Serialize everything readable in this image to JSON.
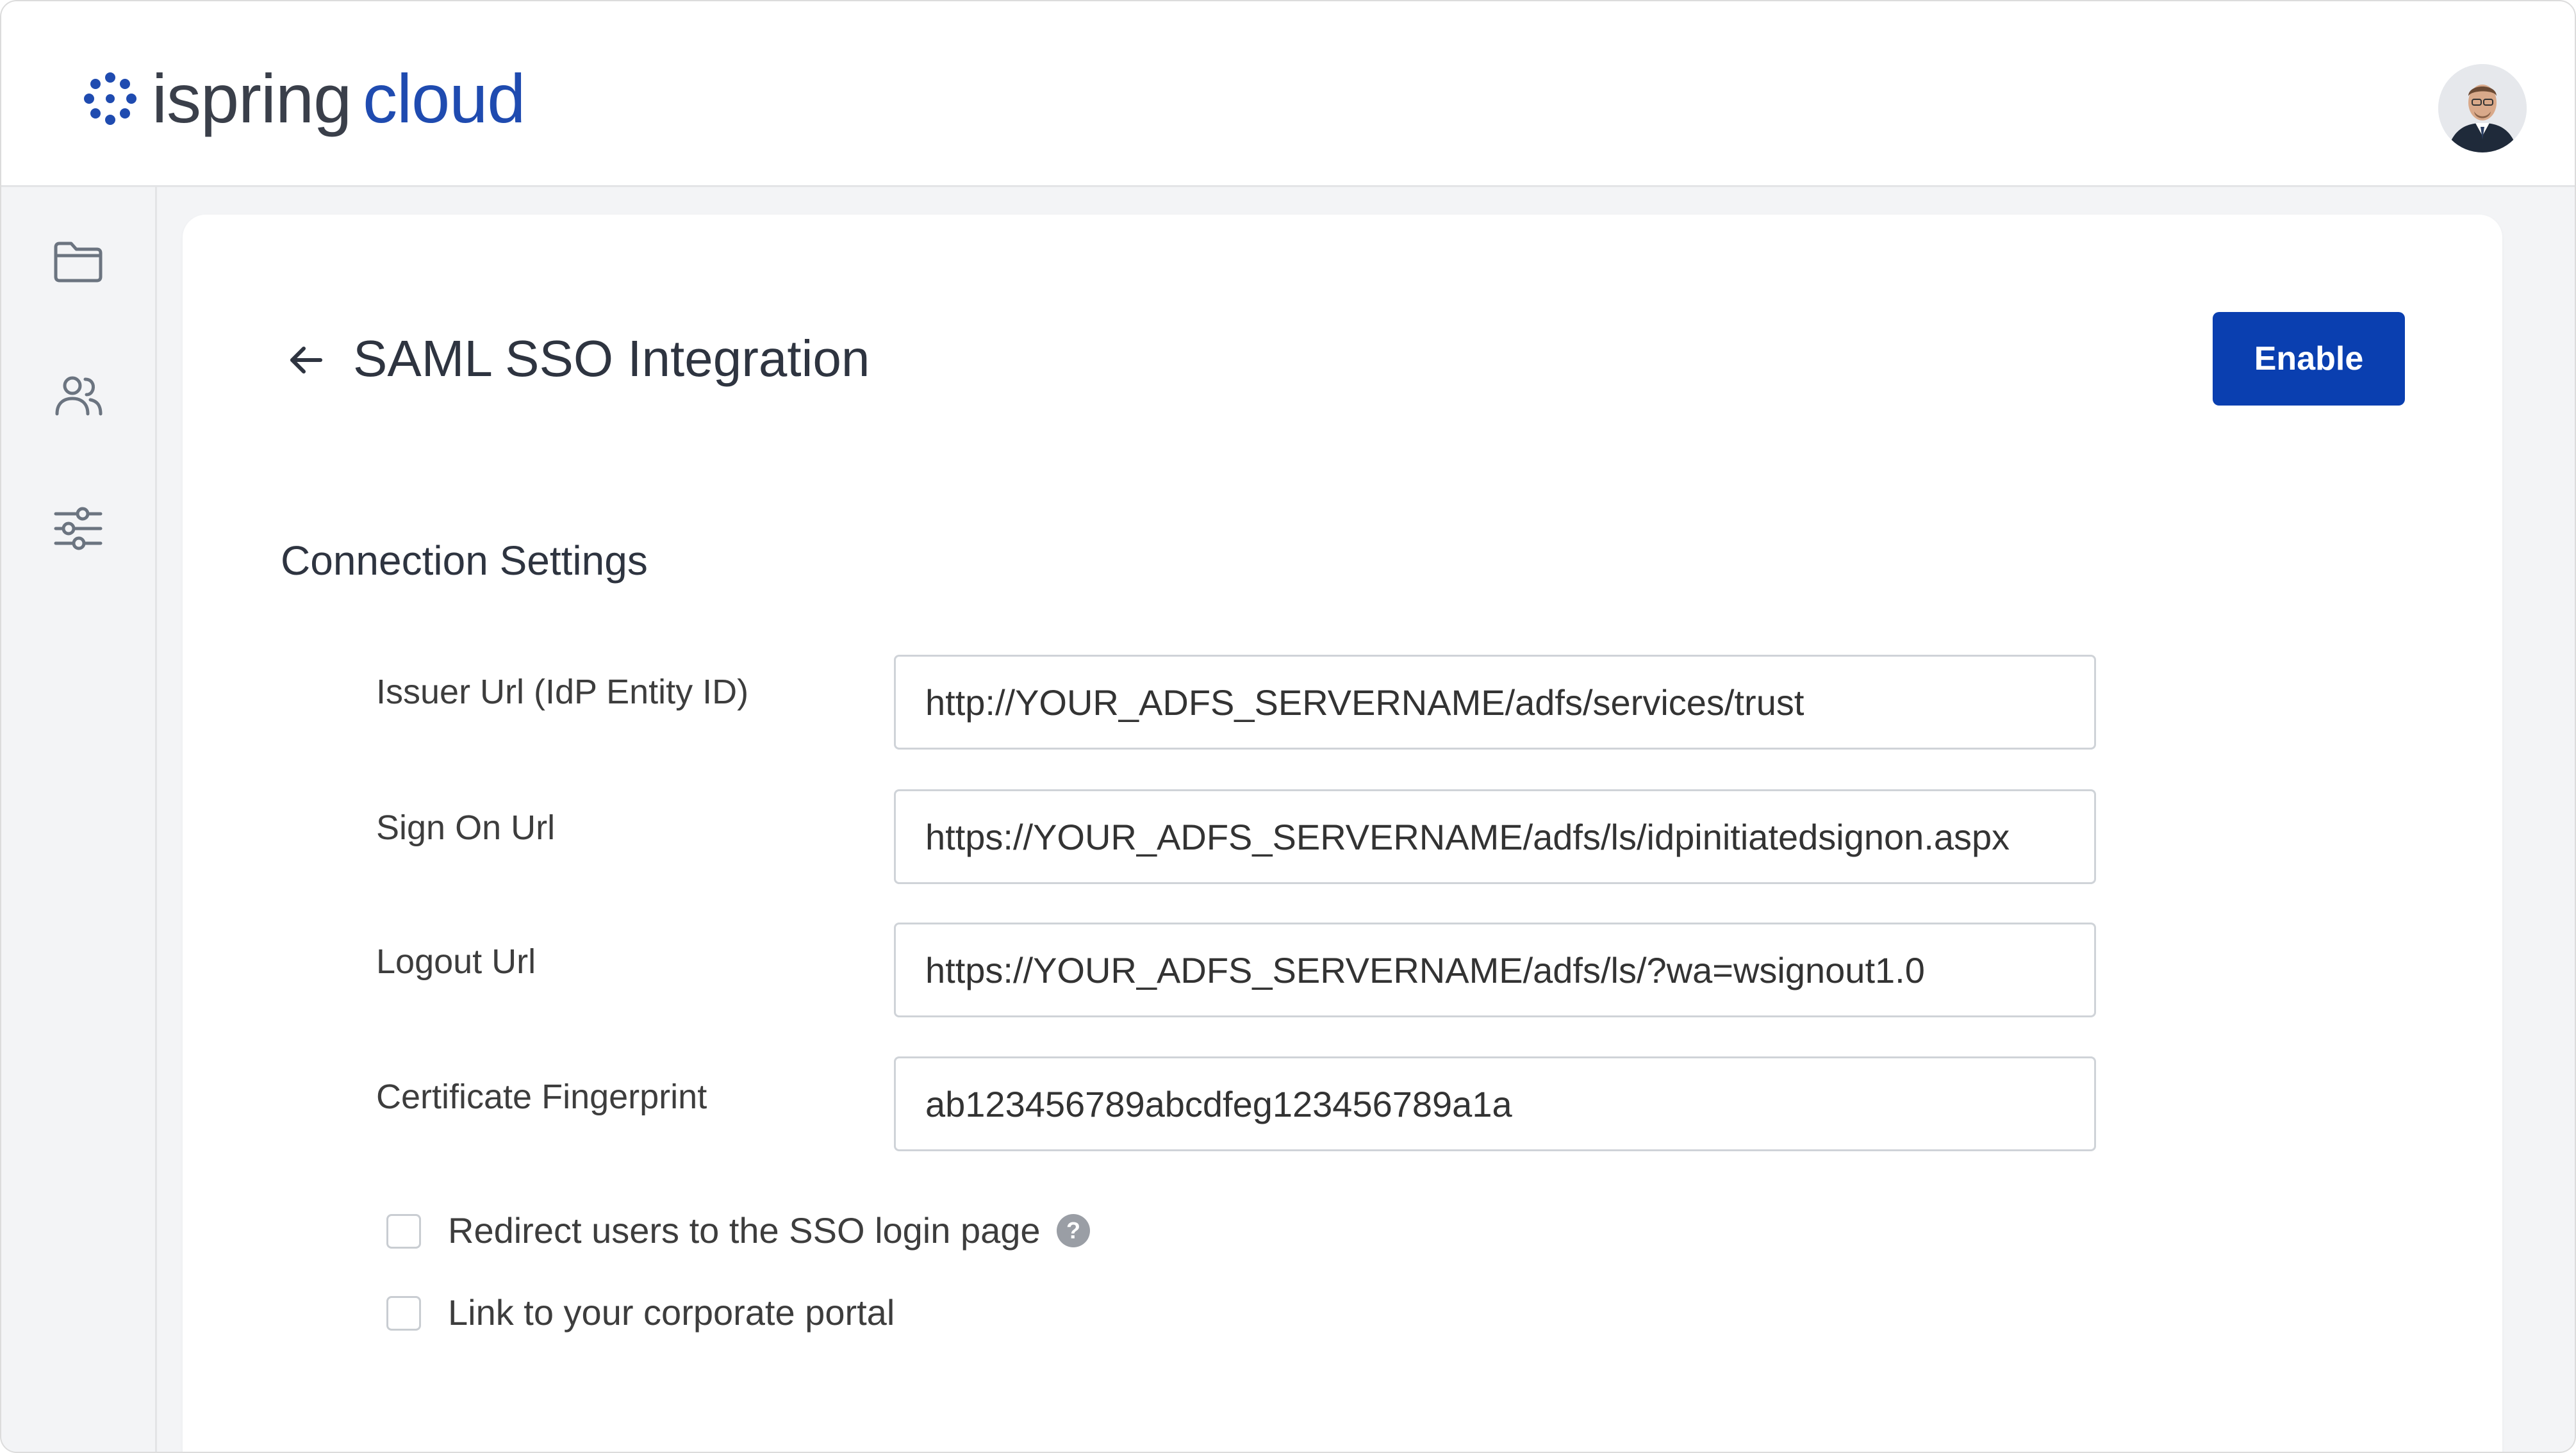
{
  "header": {
    "logo_word1": "ispring",
    "logo_word2": "cloud"
  },
  "icons": {
    "logo": "ispring-logo-icon",
    "avatar": "user-avatar",
    "sidebar": [
      "folder-icon",
      "users-icon",
      "settings-sliders-icon"
    ],
    "back": "arrow-left-icon",
    "help": "question-circle-icon"
  },
  "page": {
    "title": "SAML SSO Integration",
    "enable_label": "Enable"
  },
  "connection": {
    "section_title": "Connection Settings",
    "fields": [
      {
        "label": "Issuer Url (IdP Entity ID)",
        "value": "http://YOUR_ADFS_SERVERNAME/adfs/services/trust"
      },
      {
        "label": "Sign On Url",
        "value": "https://YOUR_ADFS_SERVERNAME/adfs/ls/idpinitiatedsignon.aspx"
      },
      {
        "label": "Logout Url",
        "value": "https://YOUR_ADFS_SERVERNAME/adfs/ls/?wa=wsignout1.0"
      },
      {
        "label": "Certificate Fingerprint",
        "value": "ab123456789abcdfeg123456789a1a"
      }
    ],
    "options": [
      {
        "label": "Redirect users to the SSO login page",
        "checked": false,
        "help_text": "?"
      },
      {
        "label": "Link to your corporate portal",
        "checked": false
      }
    ]
  },
  "colors": {
    "brand_blue": "#0a3fb0",
    "logo_blue": "#1f4bb0",
    "background": "#f3f4f6"
  }
}
